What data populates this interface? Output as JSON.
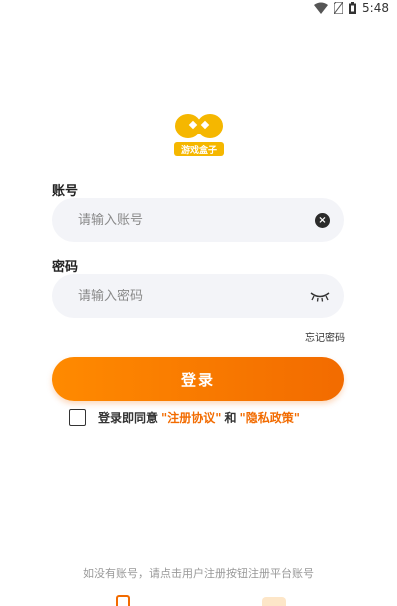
{
  "status_bar": {
    "time": "5:48"
  },
  "logo": {
    "text": "游戏盒子"
  },
  "account": {
    "label": "账号",
    "placeholder": "请输入账号",
    "value": ""
  },
  "password": {
    "label": "密码",
    "placeholder": "请输入密码",
    "value": ""
  },
  "forgot_password": "忘记密码",
  "login_button": "登录",
  "agreement": {
    "prefix": "登录即同意",
    "terms": "\"注册协议\"",
    "and": "和",
    "privacy": "\"隐私政策\""
  },
  "footer_hint": "如没有账号，请点击用户注册按钮注册平台账号",
  "colors": {
    "accent": "#f26b00",
    "field_bg": "#f3f4f8",
    "logo_yellow": "#f5b700"
  }
}
